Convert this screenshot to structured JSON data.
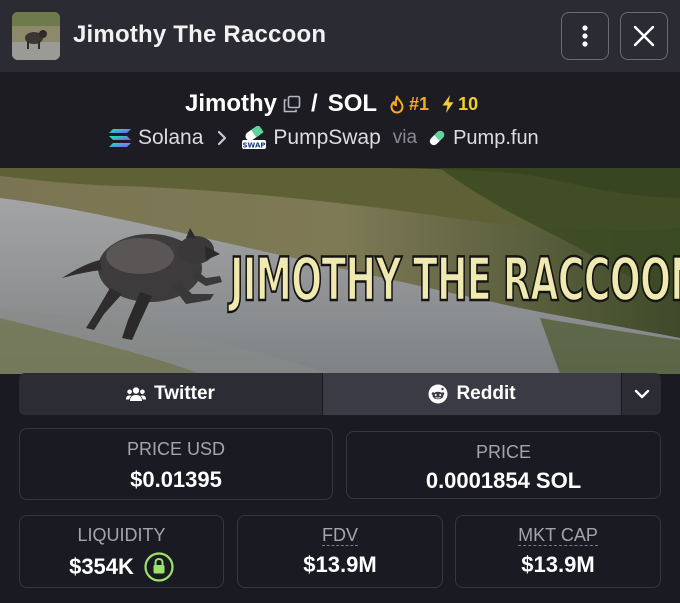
{
  "header": {
    "title": "Jimothy The Raccoon"
  },
  "pair": {
    "base": "Jimothy",
    "separator": "/",
    "quote": "SOL",
    "rank": "#1",
    "boosts": "10",
    "chain": "Solana",
    "dex": "PumpSwap",
    "dex_badge": "SWAP",
    "via": "via",
    "launchpad": "Pump.fun"
  },
  "banner": {
    "text": "JIMOTHY THE RACCOON"
  },
  "socials": {
    "twitter": "Twitter",
    "reddit": "Reddit"
  },
  "stats": {
    "price_usd": {
      "label": "PRICE USD",
      "value": "$0.01395"
    },
    "price": {
      "label": "PRICE",
      "value": "0.0001854 SOL"
    },
    "liquidity": {
      "label": "LIQUIDITY",
      "value": "$354K"
    },
    "fdv": {
      "label": "FDV",
      "value": "$13.9M"
    },
    "mkt_cap": {
      "label": "MKT CAP",
      "value": "$13.9M"
    }
  },
  "colors": {
    "rank": "#f7a928",
    "boost": "#f4cf2c",
    "lock": "#9be36b",
    "solana": [
      "#00ffa3",
      "#9945ff"
    ]
  }
}
